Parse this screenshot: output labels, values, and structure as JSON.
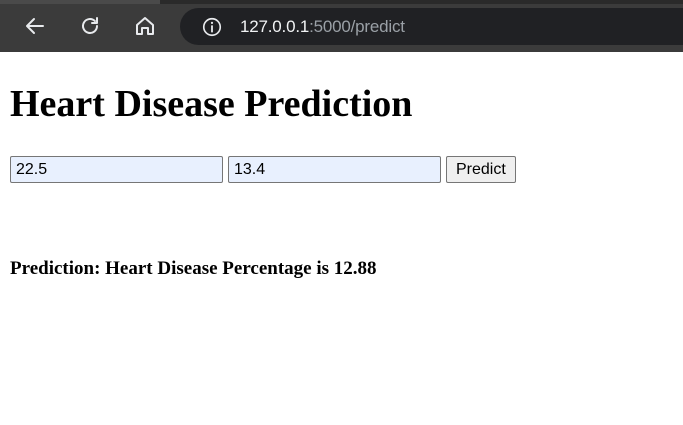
{
  "browser": {
    "url_host": "127.0.0.1",
    "url_rest": ":5000/predict",
    "icons": {
      "back": "back-arrow-icon",
      "reload": "reload-icon",
      "home": "home-icon",
      "info": "info-icon"
    }
  },
  "page": {
    "title": "Heart Disease Prediction",
    "form": {
      "input1_value": "22.5",
      "input2_value": "13.4",
      "submit_label": "Predict"
    },
    "result_text": "Prediction: Heart Disease Percentage is 12.88"
  },
  "colors": {
    "toolbar_bg": "#3b3b3b",
    "omnibox_bg": "#202124",
    "autofill_bg": "#e8f0fe"
  }
}
